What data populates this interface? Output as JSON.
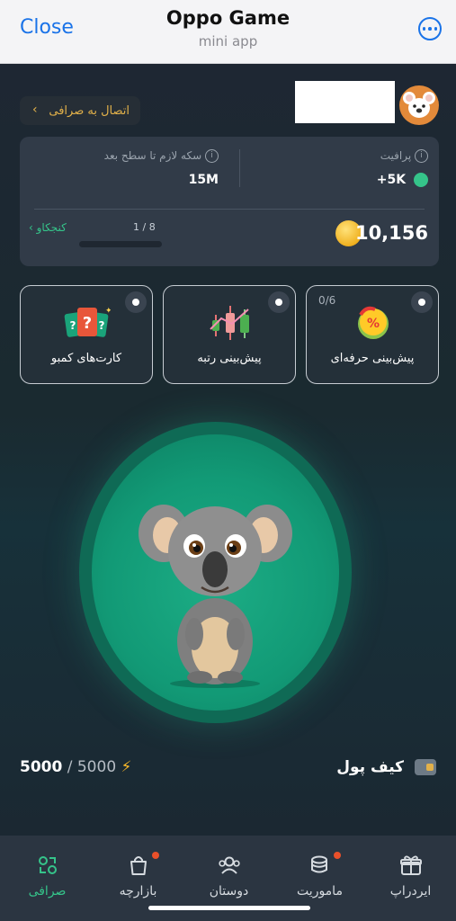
{
  "header": {
    "close_label": "Close",
    "title": "Oppo Game",
    "subtitle": "mini app"
  },
  "exchange": {
    "connect_label": "اتصال به صرافی"
  },
  "stats": {
    "profit_label": "پرافیت",
    "profit_value": "+5K",
    "next_level_label": "سکه لازم تا سطح بعد",
    "next_level_value": "15M",
    "balance": "10,156",
    "level_link": "کنجکاو",
    "level_count": "1 / 8",
    "level_progress": 0.0
  },
  "features": [
    {
      "label": "پیش‌بینی حرفه‌ای",
      "count": "0/6"
    },
    {
      "label": "پیش‌بینی رتبه"
    },
    {
      "label": "کارت‌های کمبو"
    }
  ],
  "energy": {
    "current": "5000",
    "max": "/ 5000"
  },
  "wallet": {
    "label": "کیف پول"
  },
  "nav": [
    {
      "label": "صرافی",
      "icon": "exchange-icon",
      "active": true
    },
    {
      "label": "بازارچه",
      "icon": "shopping-bag-icon",
      "badge": true
    },
    {
      "label": "دوستان",
      "icon": "friends-icon"
    },
    {
      "label": "ماموریت",
      "icon": "coins-stack-icon",
      "badge": true
    },
    {
      "label": "ایردراپ",
      "icon": "gift-icon"
    }
  ],
  "colors": {
    "accent": "#35c48a",
    "gold": "#e2b14a",
    "link": "#1a73e8",
    "badge": "#e9502a"
  }
}
